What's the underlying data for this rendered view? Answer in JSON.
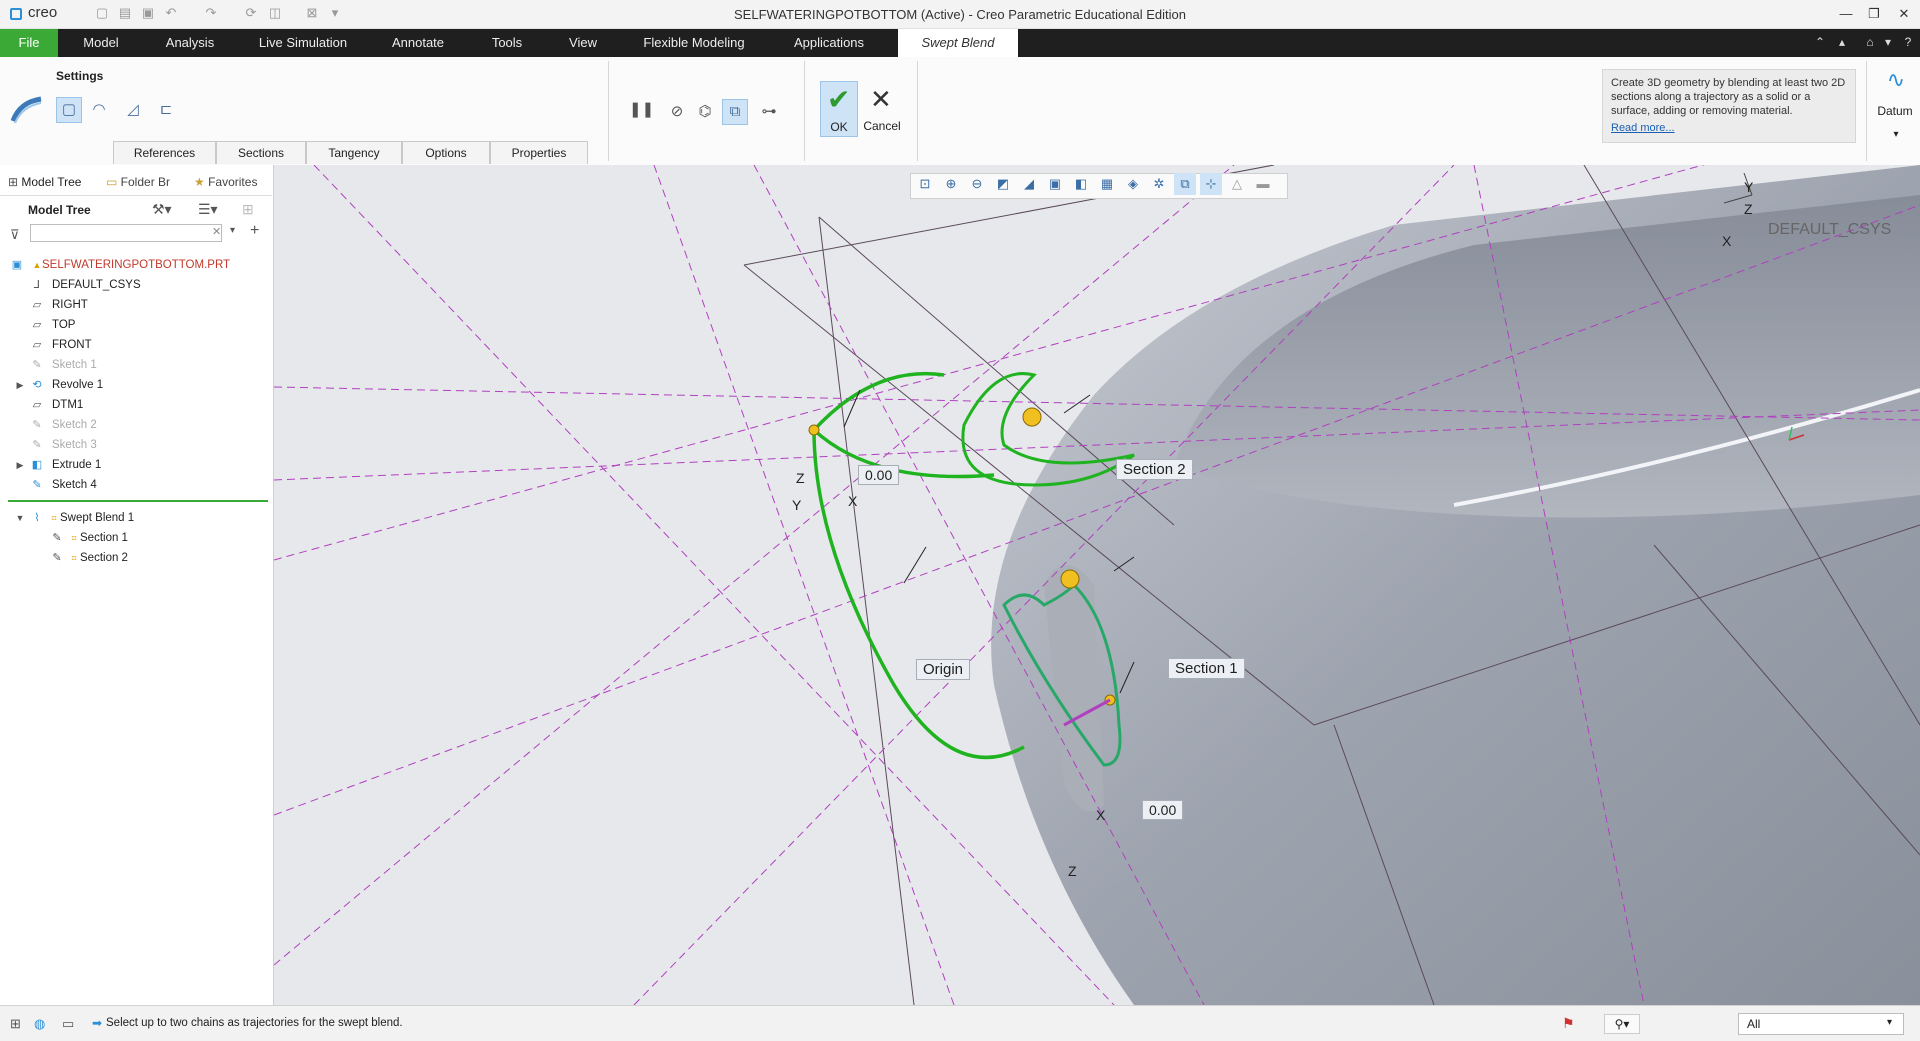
{
  "app": {
    "logo": "creo",
    "window_title": "SELFWATERINGPOTBOTTOM (Active) - Creo Parametric Educational Edition"
  },
  "ribbon_tabs": [
    "File",
    "Model",
    "Analysis",
    "Live Simulation",
    "Annotate",
    "Tools",
    "View",
    "Flexible Modeling",
    "Applications",
    "Swept Blend"
  ],
  "ribbon": {
    "settings_label": "Settings",
    "ok_label": "OK",
    "cancel_label": "Cancel",
    "help_text": "Create 3D geometry by blending at least two 2D sections along a trajectory as a solid or a surface, adding or removing material.",
    "read_more": "Read more...",
    "datum_label": "Datum",
    "sub_tabs": [
      "References",
      "Sections",
      "Tangency",
      "Options",
      "Properties"
    ]
  },
  "left_pane": {
    "tabs": [
      "Model Tree",
      "Folder Br",
      "Favorites"
    ],
    "title": "Model Tree",
    "search_placeholder": "",
    "tree": [
      {
        "label": "SELFWATERINGPOTBOTTOM.PRT",
        "icon": "part-icon",
        "state": "root"
      },
      {
        "label": "DEFAULT_CSYS",
        "icon": "csys-icon",
        "state": "normal"
      },
      {
        "label": "RIGHT",
        "icon": "datum-plane-icon",
        "state": "normal"
      },
      {
        "label": "TOP",
        "icon": "datum-plane-icon",
        "state": "normal"
      },
      {
        "label": "FRONT",
        "icon": "datum-plane-icon",
        "state": "normal"
      },
      {
        "label": "Sketch 1",
        "icon": "sketch-icon",
        "state": "dim"
      },
      {
        "label": "Revolve 1",
        "icon": "revolve-icon",
        "state": "expandable"
      },
      {
        "label": "DTM1",
        "icon": "datum-plane-icon",
        "state": "normal"
      },
      {
        "label": "Sketch 2",
        "icon": "sketch-icon",
        "state": "dim"
      },
      {
        "label": "Sketch 3",
        "icon": "sketch-icon",
        "state": "dim"
      },
      {
        "label": "Extrude 1",
        "icon": "extrude-icon",
        "state": "expandable"
      },
      {
        "label": "Sketch 4",
        "icon": "sketch-icon",
        "state": "normal"
      },
      {
        "label": "Swept Blend 1",
        "icon": "swept-blend-icon",
        "state": "expanded"
      },
      {
        "label": "Section 1",
        "icon": "section-sketch-icon",
        "state": "child"
      },
      {
        "label": "Section 2",
        "icon": "section-sketch-icon",
        "state": "child"
      }
    ]
  },
  "viewport": {
    "callouts": {
      "section2": "Section 2",
      "section1": "Section 1",
      "origin": "Origin",
      "dim_top": "0.00",
      "dim_bottom": "0.00"
    },
    "csys_label": "DEFAULT_CSYS",
    "axis_labels": {
      "z": "Z",
      "y": "Y",
      "x": "X"
    }
  },
  "status": {
    "message": "Select up to two chains as trajectories for the swept blend.",
    "filter_value": "All"
  },
  "colors": {
    "file_tab": "#3aa935",
    "trajectory": "#1fb41f",
    "datum_line": "#b040c0"
  }
}
